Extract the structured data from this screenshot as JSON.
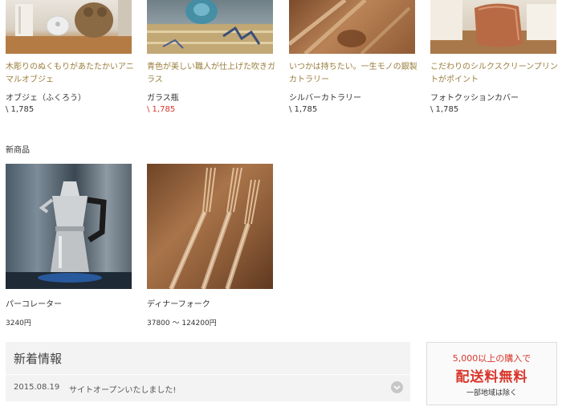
{
  "products": [
    {
      "description": "木彫りのぬくもりがあたたかいアニマルオブジェ",
      "name": "オブジェ（ふくろう）",
      "price": "\\ 1,785",
      "sale": false
    },
    {
      "description": "青色が美しい職人が仕上げた吹きガラス",
      "name": "ガラス瓶",
      "price": "\\ 1,785",
      "sale": true
    },
    {
      "description": "いつかは持ちたい。一生モノの銀製カトラリー",
      "name": "シルバーカトラリー",
      "price": "\\ 1,785",
      "sale": false
    },
    {
      "description": "こだわりのシルクスクリーンプリントがポイント",
      "name": "フォトクッションカバー",
      "price": "\\ 1,785",
      "sale": false
    }
  ],
  "new_products": {
    "title": "新商品",
    "items": [
      {
        "name": "パーコレーター",
        "price": "3240円"
      },
      {
        "name": "ディナーフォーク",
        "price": "37800 〜 124200円"
      }
    ]
  },
  "news": {
    "title": "新着情報",
    "items": [
      {
        "date": "2015.08.19",
        "text": "サイトオープンいたしました!"
      }
    ]
  },
  "shipping": {
    "line1": "5,000以上の購入で",
    "line2": "配送料無料",
    "line3": "一部地域は除く"
  },
  "colors": {
    "accent_red": "#d9362a",
    "desc_gold": "#9a7d3c"
  }
}
